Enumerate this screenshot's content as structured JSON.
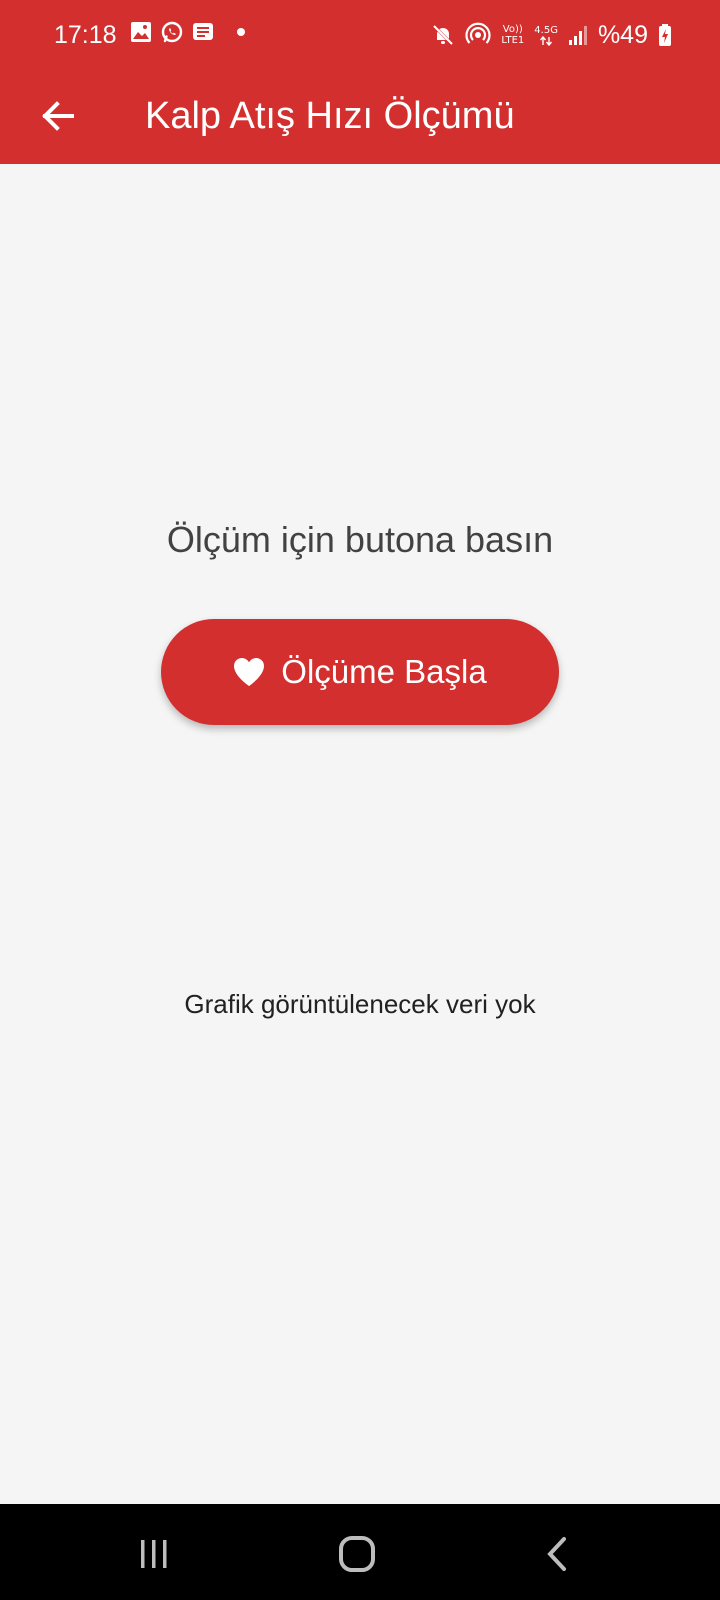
{
  "status_bar": {
    "time": "17:18",
    "left_icons": [
      "image-icon",
      "whatsapp-icon",
      "message-icon",
      "dot-icon"
    ],
    "network_top": "Vo))",
    "network_bottom": "LTE1",
    "network_type": "4.5G",
    "battery": "%49"
  },
  "header": {
    "title": "Kalp Atış Hızı Ölçümü",
    "background_color": "#d32f2f"
  },
  "main": {
    "prompt": "Ölçüm için butona basın",
    "start_button_label": "Ölçüme Başla",
    "empty_chart_message": "Grafik görüntülenecek veri yok"
  },
  "colors": {
    "accent": "#d32f2f",
    "background": "#f5f5f5",
    "navbar": "#000000"
  }
}
